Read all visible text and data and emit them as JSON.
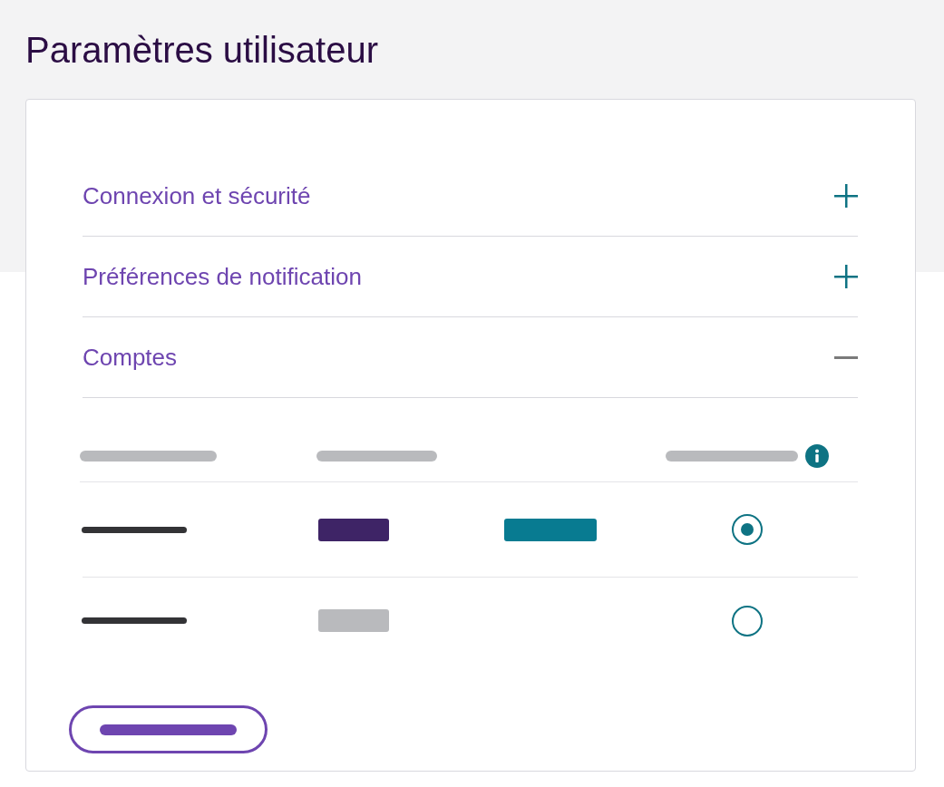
{
  "title": "Paramètres utilisateur",
  "sections": [
    {
      "title": "Connexion et sécurité",
      "expanded": false
    },
    {
      "title": "Préférences de notification",
      "expanded": false
    },
    {
      "title": "Comptes",
      "expanded": true
    }
  ],
  "accounts": [
    {
      "selected": true,
      "badges": [
        {
          "color": "#3e2466"
        },
        {
          "color": "#087b91"
        }
      ]
    },
    {
      "selected": false,
      "badges": [
        {
          "color": "#b9babd"
        }
      ]
    }
  ]
}
